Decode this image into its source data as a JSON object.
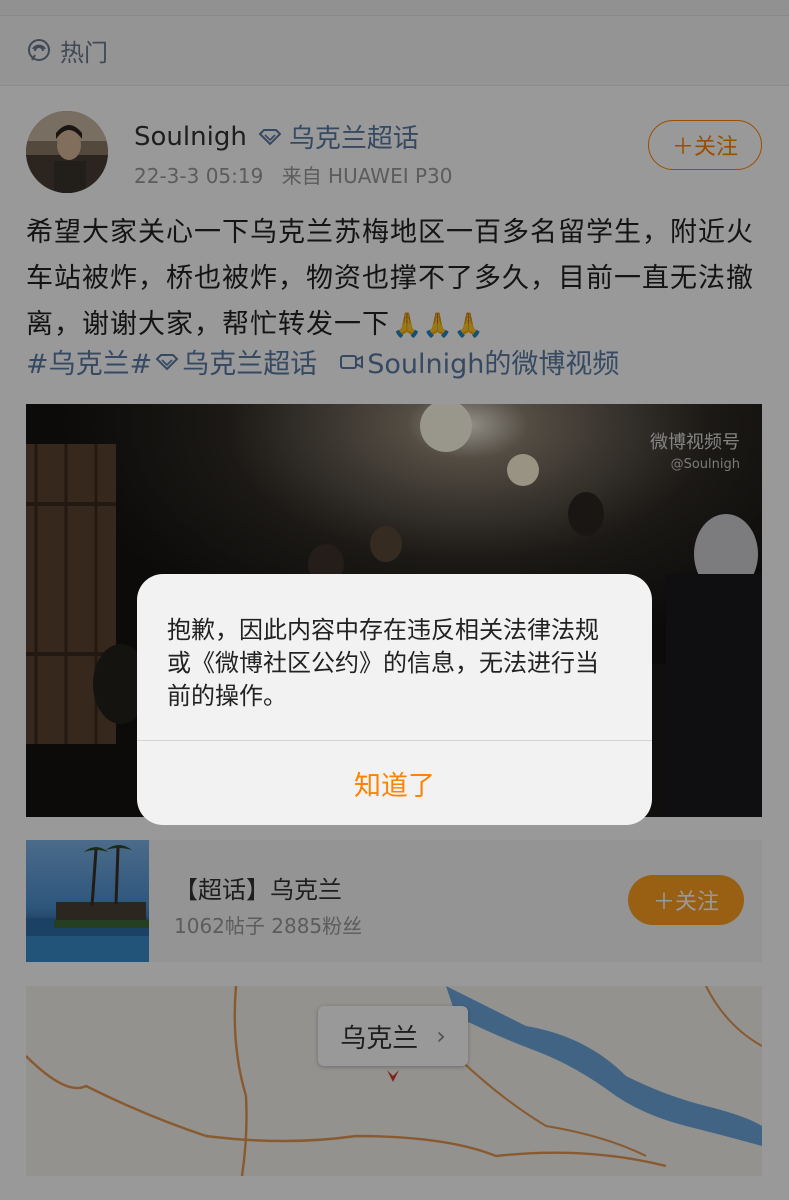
{
  "hot_bar": {
    "label": "热门",
    "icon": "hot-topic-icon"
  },
  "post": {
    "author": "Soulnigh",
    "super_topic": "乌克兰超话",
    "time": "22-3-3 05:19",
    "source": "来自 HUAWEI P30",
    "follow_label": "＋关注",
    "text": "希望大家关心一下乌克兰苏梅地区一百多名留学生，附近火车站被炸，桥也被炸，物资也撑不了多久，目前一直无法撤离，谢谢大家，帮忙转发一下",
    "emoji": "🙏🙏🙏",
    "tags": {
      "tag1": "#乌克兰#",
      "tag2": "乌克兰超话",
      "video_link": "Soulnigh的微博视频"
    },
    "video": {
      "watermark": "微博视频号",
      "watermark_sub": "@Soulnigh"
    }
  },
  "topic_card": {
    "title": "【超话】乌克兰",
    "stats": "1062帖子 2885粉丝",
    "follow_label": "＋关注"
  },
  "map": {
    "location_label": "乌克兰",
    "chevron": "›"
  },
  "dialog": {
    "message": "抱歉，因此内容中存在违反相关法律法规或《微博社区公约》的信息，无法进行当前的操作。",
    "ok_label": "知道了"
  },
  "colors": {
    "accent": "#ff8200",
    "link": "#5b7ba3"
  }
}
